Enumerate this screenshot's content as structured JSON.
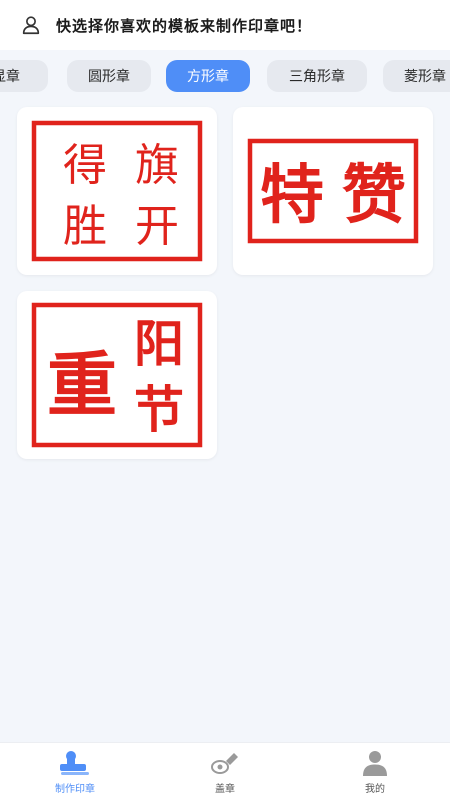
{
  "header": {
    "title": "快选择你喜欢的模板来制作印章吧！"
  },
  "tabs": [
    {
      "label": "显章",
      "active": false
    },
    {
      "label": "圆形章",
      "active": false
    },
    {
      "label": "方形章",
      "active": true
    },
    {
      "label": "三角形章",
      "active": false
    },
    {
      "label": "菱形章",
      "active": false
    }
  ],
  "templates": [
    {
      "chars": [
        "得",
        "旗",
        "胜",
        "开"
      ]
    },
    {
      "chars": [
        "特",
        "赞"
      ]
    },
    {
      "chars": [
        "重",
        "阳",
        "节"
      ]
    }
  ],
  "nav": [
    {
      "label": "制作印章",
      "active": true
    },
    {
      "label": "盖章",
      "active": false
    },
    {
      "label": "我的",
      "active": false
    }
  ],
  "colors": {
    "accent": "#4f8ef7",
    "seal_red": "#e0231c"
  }
}
